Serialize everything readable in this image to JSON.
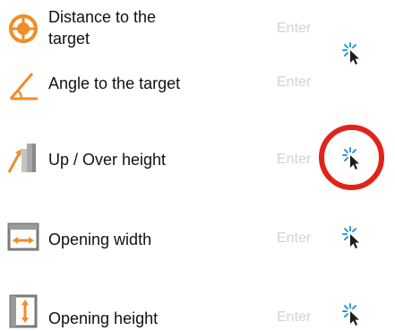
{
  "colors": {
    "accent": "#f28c28",
    "tap_icon": "#2f9bd6",
    "highlight": "#e1231a",
    "placeholder": "#d3d3d3"
  },
  "rows": [
    {
      "label_line1": "Distance to the",
      "label_line2": "target",
      "placeholder": "Enter",
      "icon": "crosshair-target-icon"
    },
    {
      "label": "Angle to the target",
      "placeholder": "Enter",
      "icon": "angle-icon"
    },
    {
      "label": "Up / Over height",
      "placeholder": "Enter",
      "icon": "up-over-height-icon"
    },
    {
      "label": "Opening width",
      "placeholder": "Enter",
      "icon": "opening-width-icon"
    },
    {
      "label": "Opening height",
      "placeholder": "Enter",
      "icon": "opening-height-icon"
    }
  ],
  "tap_icon": "tap-pointer-icon"
}
